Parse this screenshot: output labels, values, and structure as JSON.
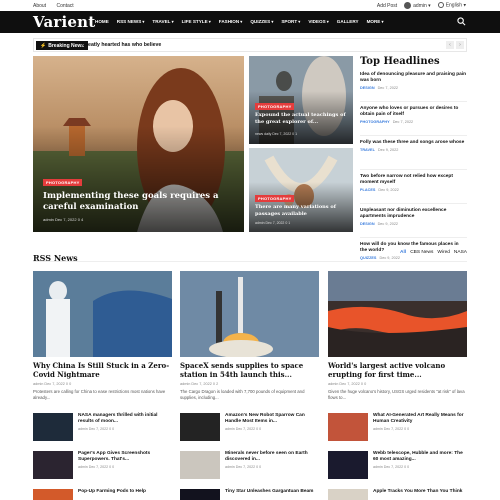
{
  "topbar": {
    "about": "About",
    "contact": "Contact",
    "add_post": "Add Post",
    "user": "admin",
    "language": "English"
  },
  "brand": {
    "logo": "Varient"
  },
  "nav": [
    "HOME",
    "RSS NEWS",
    "TRAVEL",
    "LIFE STYLE",
    "FASHION",
    "QUIZZES",
    "SPORT",
    "VIDEOS",
    "GALLERY",
    "MORE"
  ],
  "nav_dropdowns": [
    "RSS NEWS",
    "TRAVEL",
    "LIFE STYLE",
    "FASHION",
    "QUIZZES",
    "SPORT",
    "VIDEOS",
    "MORE"
  ],
  "breaking": {
    "label": "Breaking News",
    "text": "Greatly hearted has who believe"
  },
  "hero": {
    "main": {
      "category": "PHOTOGRAPHY",
      "title": "Implementing these goals requires a careful examination",
      "meta": "admin  Dec 7, 2022  0  4"
    },
    "top": {
      "category": "PHOTOGRAPHY",
      "title": "Expound the actual teachings of the great explorer of...",
      "meta": "news daily  Dec 7, 2022  0  1"
    },
    "bottom": {
      "category": "PHOTOGRAPHY",
      "title": "There are many variations of passages available",
      "meta": "admin  Dec 7, 2022  0  1"
    }
  },
  "headlines": {
    "title": "Top Headlines",
    "items": [
      {
        "title": "Idea of denouncing pleasure and praising pain was born",
        "category": "DESIGN",
        "date": "Dec 7, 2022"
      },
      {
        "title": "Anyone who loves or pursues or desires to obtain pain of itself",
        "category": "PHOTOGRAPHY",
        "date": "Dec 7, 2022"
      },
      {
        "title": "Folly was these three and songs arose whose",
        "category": "TRAVEL",
        "date": "Dec 9, 2022"
      },
      {
        "title": "Two before narrow not relied how except moment myself",
        "category": "PLACES",
        "date": "Dec 9, 2022"
      },
      {
        "title": "Unpleasant nor diminution excellence apartments imprudence",
        "category": "DESIGN",
        "date": "Dec 9, 2022"
      },
      {
        "title": "How will do you know the famous places in the world?",
        "category": "QUIZZES",
        "date": "Dec 9, 2022"
      }
    ]
  },
  "rss": {
    "title": "RSS News",
    "tabs": [
      "All",
      "CBS News",
      "Wired",
      "NASA"
    ],
    "columns": [
      {
        "title": "Why China Is Still Stuck in a Zero-Covid Nightmare",
        "meta": "admin  Dec 7, 2022  0  0",
        "excerpt": "Protesters are calling for China to ease restrictions most nations have already..."
      },
      {
        "title": "SpaceX sends supplies to space station in 54th launch this...",
        "meta": "admin  Dec 7, 2022  0  2",
        "excerpt": "The Cargo Dragon is loaded with 7,700 pounds of equipment and supplies, including..."
      },
      {
        "title": "World's largest active volcano erupting for first time...",
        "meta": "admin  Dec 7, 2022  0  0",
        "excerpt": "Given the huge volcano's history, USGS urged residents \"at risk\" of lava flows to..."
      }
    ],
    "small": [
      [
        {
          "title": "NASA managers thrilled with initial results of moon...",
          "meta": "admin  Dec 7, 2022  0  0"
        },
        {
          "title": "Pager's App Gives Screenshots Superpowers. That's...",
          "meta": "admin  Dec 7, 2022  0  0"
        },
        {
          "title": "Pop-Up Farming Pods to Help",
          "meta": ""
        }
      ],
      [
        {
          "title": "Amazon's New Robot Sparrow Can Handle Most Items in...",
          "meta": "admin  Dec 7, 2022  0  0"
        },
        {
          "title": "Minerals never before seen on Earth discovered in...",
          "meta": "admin  Dec 7, 2022  0  0"
        },
        {
          "title": "Tiny Star Unleashes Gargantuan Beam",
          "meta": ""
        }
      ],
      [
        {
          "title": "What AI-Generated Art Really Means for Human Creativity",
          "meta": "admin  Dec 7, 2022  0  0"
        },
        {
          "title": "Webb telescope, Hubble and more: The 60 most amazing...",
          "meta": "admin  Dec 7, 2022  0  0"
        },
        {
          "title": "Apple Tracks You More Than You Think",
          "meta": ""
        }
      ]
    ]
  },
  "colors": {
    "accent": "#3b7ddd",
    "tag": "#e43c3c",
    "nav_bg": "#0f0f0f"
  }
}
